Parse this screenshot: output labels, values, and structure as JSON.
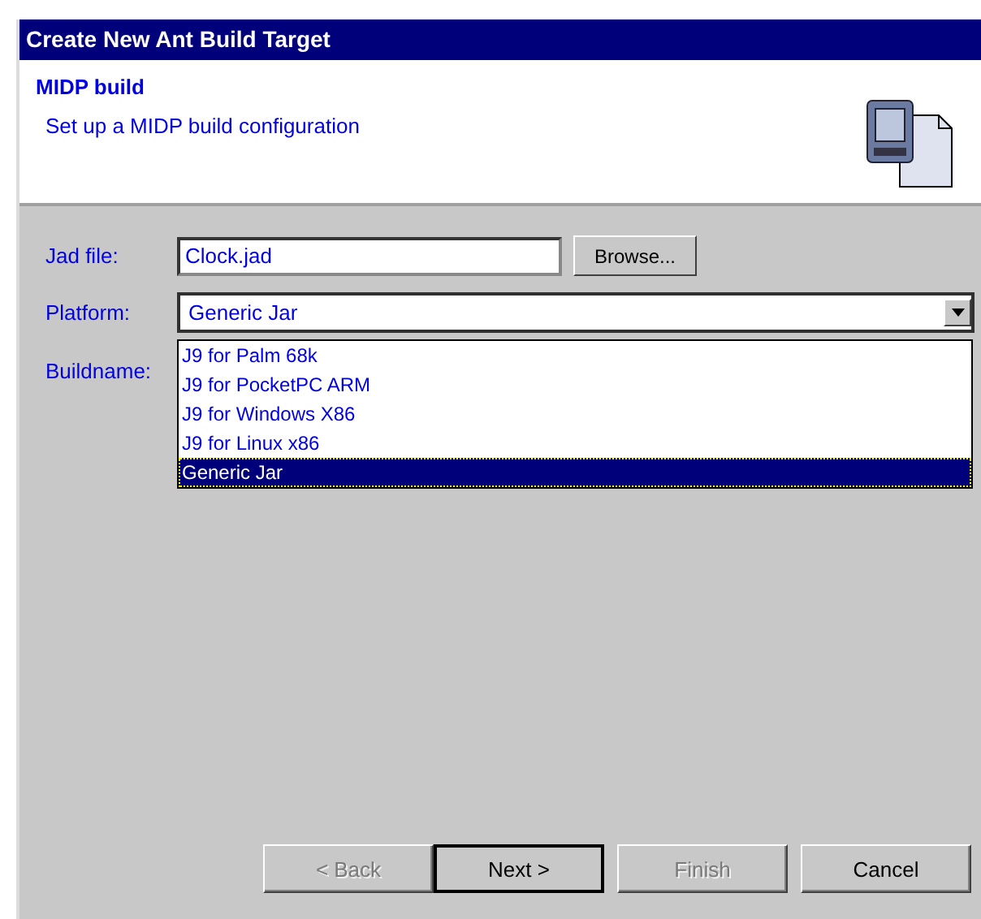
{
  "window": {
    "title": "Create New Ant Build Target"
  },
  "header": {
    "title": "MIDP build",
    "subtitle": "Set up a MIDP build configuration"
  },
  "form": {
    "jad_file": {
      "label": "Jad file:",
      "value": "Clock.jad",
      "button": "Browse..."
    },
    "platform": {
      "label": "Platform:",
      "value": "Generic Jar",
      "expanded": true,
      "options": [
        {
          "label": "J9 for Palm 68k",
          "selected": false
        },
        {
          "label": "J9 for PocketPC ARM",
          "selected": false
        },
        {
          "label": "J9 for Windows X86",
          "selected": false
        },
        {
          "label": "J9 for Linux x86",
          "selected": false
        },
        {
          "label": "Generic Jar",
          "selected": true
        }
      ]
    },
    "buildname": {
      "label": "Buildname:"
    }
  },
  "buttons": [
    {
      "label": "< Back",
      "disabled": true,
      "default": false
    },
    {
      "label": "Next >",
      "disabled": false,
      "default": true
    },
    {
      "label": "Finish",
      "disabled": true,
      "default": false
    },
    {
      "label": "Cancel",
      "disabled": false,
      "default": false
    }
  ]
}
